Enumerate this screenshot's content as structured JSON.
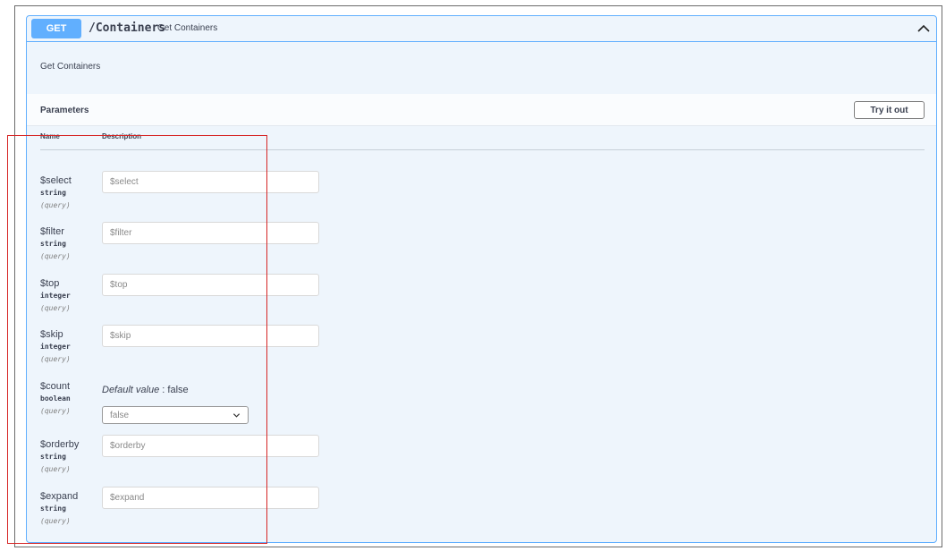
{
  "operation": {
    "method": "GET",
    "path": "/Containers",
    "summary": "Get Containers",
    "description": "Get Containers"
  },
  "parameters_section": {
    "title": "Parameters",
    "try_button_label": "Try it out",
    "column_name": "Name",
    "column_description": "Description"
  },
  "params": [
    {
      "name": "$select",
      "type": "string",
      "in": "(query)",
      "placeholder": "$select"
    },
    {
      "name": "$filter",
      "type": "string",
      "in": "(query)",
      "placeholder": "$filter"
    },
    {
      "name": "$top",
      "type": "integer",
      "in": "(query)",
      "placeholder": "$top"
    },
    {
      "name": "$skip",
      "type": "integer",
      "in": "(query)",
      "placeholder": "$skip"
    },
    {
      "name": "$count",
      "type": "boolean",
      "in": "(query)",
      "default_label": "Default value",
      "default_value": ": false",
      "selected": "false"
    },
    {
      "name": "$orderby",
      "type": "string",
      "in": "(query)",
      "placeholder": "$orderby"
    },
    {
      "name": "$expand",
      "type": "string",
      "in": "(query)",
      "placeholder": "$expand"
    }
  ],
  "colors": {
    "get_accent": "#61affe",
    "panel_bg": "#eef5fc",
    "highlight_box": "#d62626"
  },
  "icons": {
    "collapse": "chevron-up-icon",
    "select_arrow": "chevron-down-icon"
  }
}
